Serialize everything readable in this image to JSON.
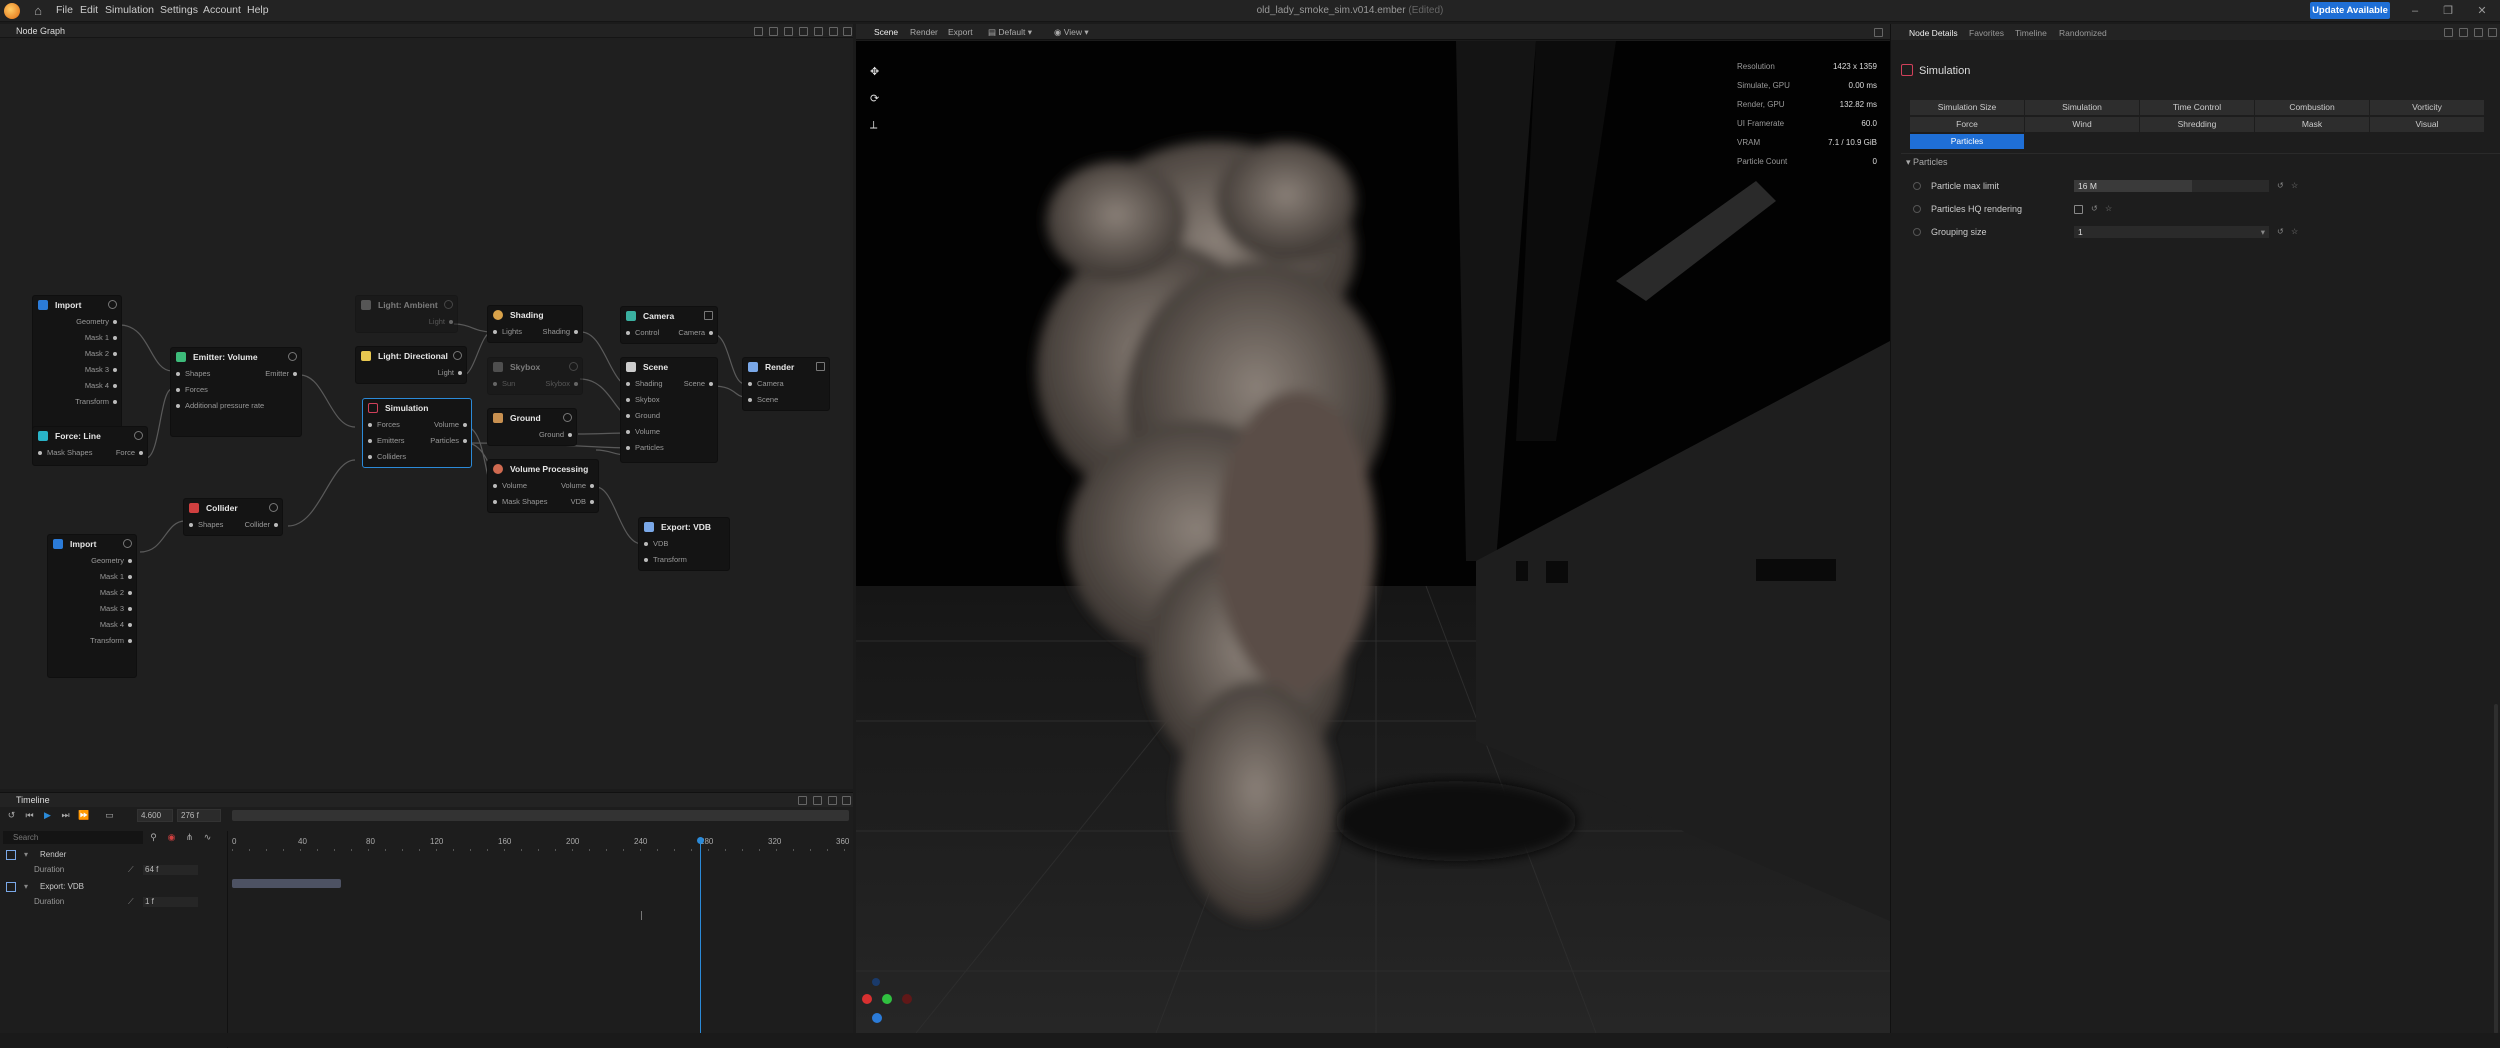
{
  "app": {
    "menu": [
      "File",
      "Edit",
      "Simulation",
      "Settings",
      "Account",
      "Help"
    ],
    "doc_title": "old_lady_smoke_sim.v014.ember",
    "doc_state": "(Edited)",
    "update_label": "Update Available"
  },
  "node_graph": {
    "title": "Node Graph",
    "nodes": {
      "import1": {
        "title": "Import",
        "ports": [
          "Geometry",
          "Mask 1",
          "Mask 2",
          "Mask 3",
          "Mask 4",
          "Transform"
        ]
      },
      "force_line": {
        "title": "Force: Line",
        "in": "Mask Shapes",
        "out": "Force"
      },
      "emitter": {
        "title": "Emitter: Volume",
        "ports": [
          "Shapes",
          "Forces",
          "Additional pressure rate"
        ],
        "out": "Emitter"
      },
      "light_ambient": {
        "title": "Light: Ambient",
        "out": "Light"
      },
      "light_dir": {
        "title": "Light: Directional",
        "out": "Light"
      },
      "shading": {
        "title": "Shading",
        "in": "Lights",
        "out": "Shading"
      },
      "skybox": {
        "title": "Skybox",
        "in": "Sun",
        "out": "Skybox"
      },
      "camera": {
        "title": "Camera",
        "in": "Control",
        "out": "Camera"
      },
      "scene": {
        "title": "Scene",
        "in": "Shading",
        "out": "Scene",
        "ports": [
          "Skybox",
          "Ground",
          "Volume",
          "Particles"
        ]
      },
      "render": {
        "title": "Render",
        "ports": [
          "Camera",
          "Scene"
        ]
      },
      "simulation": {
        "title": "Simulation",
        "rows": [
          [
            "Forces",
            "Volume"
          ],
          [
            "Emitters",
            "Particles"
          ],
          [
            "Colliders",
            ""
          ]
        ]
      },
      "ground": {
        "title": "Ground",
        "out": "Ground"
      },
      "volproc": {
        "title": "Volume Processing",
        "rows": [
          [
            "Volume",
            "Volume"
          ],
          [
            "Mask Shapes",
            "VDB"
          ]
        ]
      },
      "collider": {
        "title": "Collider",
        "in": "Shapes",
        "out": "Collider"
      },
      "export_vdb": {
        "title": "Export: VDB",
        "ports": [
          "VDB",
          "Transform"
        ]
      },
      "import2": {
        "title": "Import",
        "ports": [
          "Geometry",
          "Mask 1",
          "Mask 2",
          "Mask 3",
          "Mask 4",
          "Transform"
        ]
      }
    }
  },
  "timeline": {
    "title": "Timeline",
    "speed": "4.600",
    "frame": "276 f",
    "search_placeholder": "Search",
    "ticks": [
      "0",
      "40",
      "80",
      "120",
      "160",
      "200",
      "240",
      "280",
      "320",
      "360"
    ],
    "tracks": [
      {
        "name": "Render",
        "param": "Duration",
        "value": "64 f"
      },
      {
        "name": "Export: VDB",
        "param": "Duration",
        "value": "1 f"
      }
    ]
  },
  "viewport": {
    "tabs": [
      "Scene",
      "Render",
      "Export"
    ],
    "preset": "Default",
    "view": "View",
    "stats": [
      {
        "k": "Resolution",
        "v": "1423 x 1359"
      },
      {
        "k": "Simulate, GPU",
        "v": "0.00 ms"
      },
      {
        "k": "Render, GPU",
        "v": "132.82 ms"
      },
      {
        "k": "UI Framerate",
        "v": "60.0"
      },
      {
        "k": "VRAM",
        "v": "7.1 / 10.9 GiB"
      },
      {
        "k": "Particle Count",
        "v": "0"
      }
    ]
  },
  "details": {
    "tabs": [
      "Node Details",
      "Favorites",
      "Timeline",
      "Randomized"
    ],
    "title": "Simulation",
    "prop_tabs_row1": [
      "Simulation Size",
      "Simulation",
      "Time Control",
      "Combustion",
      "Vorticity"
    ],
    "prop_tabs_row2": [
      "Force",
      "Wind",
      "Shredding",
      "Mask",
      "Visual"
    ],
    "prop_tab_active": "Particles",
    "section": "Particles",
    "props": {
      "max_limit_label": "Particle max limit",
      "max_limit_value": "16 M",
      "hq_label": "Particles HQ rendering",
      "grouping_label": "Grouping size",
      "grouping_value": "1"
    }
  },
  "colors": {
    "accent": "#1f6fd6",
    "selection": "#2b8ad8",
    "sim_icon": "#d0405a"
  }
}
